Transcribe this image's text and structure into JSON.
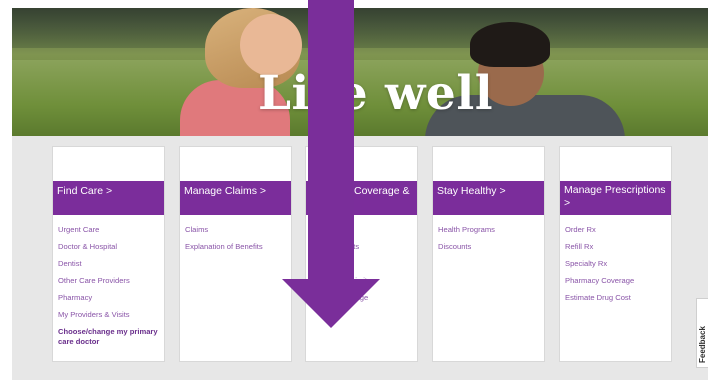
{
  "hero": {
    "headline": "Live well"
  },
  "cards": [
    {
      "title": "Find Care >",
      "items": [
        "Urgent Care",
        "Doctor & Hospital",
        "Dentist",
        "Other Care Providers",
        "Pharmacy",
        "My Providers & Visits"
      ],
      "bold_item": "Choose/change my primary care doctor"
    },
    {
      "title": "Manage Claims >",
      "items": [
        "Claims",
        "Explanation of Benefits"
      ]
    },
    {
      "title": "Coverage &",
      "items": [
        "nts",
        "Limit",
        "rage"
      ]
    },
    {
      "title": "Stay Healthy >",
      "items": [
        "Health Programs",
        "Discounts"
      ]
    },
    {
      "title": "Manage Prescriptions >",
      "items": [
        "Order Rx",
        "Refill Rx",
        "Specialty Rx",
        "Pharmacy Coverage",
        "Estimate Drug Cost"
      ]
    }
  ],
  "feedback": {
    "label": "Feedback"
  },
  "colors": {
    "accent": "#7b2d9b",
    "link": "#8a55a8",
    "arrow": "#7a2e9a"
  }
}
